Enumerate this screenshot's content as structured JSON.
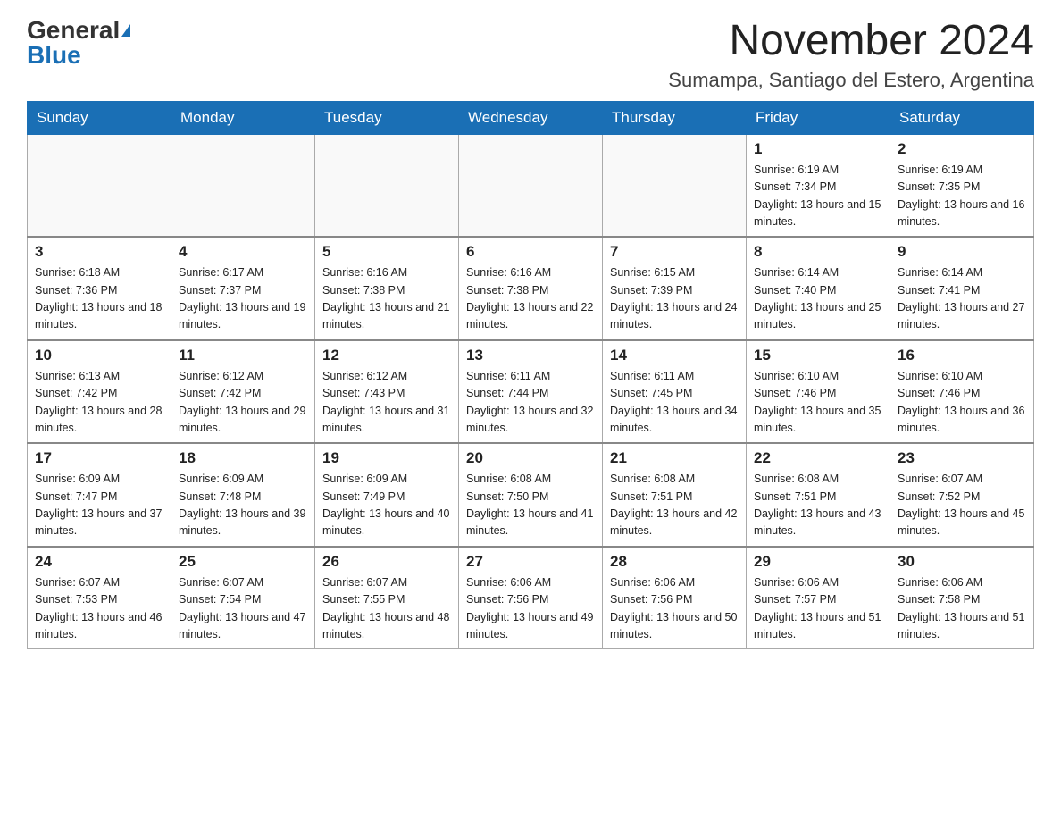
{
  "header": {
    "logo_general": "General",
    "logo_blue": "Blue",
    "month_title": "November 2024",
    "subtitle": "Sumampa, Santiago del Estero, Argentina"
  },
  "weekdays": [
    "Sunday",
    "Monday",
    "Tuesday",
    "Wednesday",
    "Thursday",
    "Friday",
    "Saturday"
  ],
  "weeks": [
    [
      {
        "day": "",
        "info": ""
      },
      {
        "day": "",
        "info": ""
      },
      {
        "day": "",
        "info": ""
      },
      {
        "day": "",
        "info": ""
      },
      {
        "day": "",
        "info": ""
      },
      {
        "day": "1",
        "info": "Sunrise: 6:19 AM\nSunset: 7:34 PM\nDaylight: 13 hours and 15 minutes."
      },
      {
        "day": "2",
        "info": "Sunrise: 6:19 AM\nSunset: 7:35 PM\nDaylight: 13 hours and 16 minutes."
      }
    ],
    [
      {
        "day": "3",
        "info": "Sunrise: 6:18 AM\nSunset: 7:36 PM\nDaylight: 13 hours and 18 minutes."
      },
      {
        "day": "4",
        "info": "Sunrise: 6:17 AM\nSunset: 7:37 PM\nDaylight: 13 hours and 19 minutes."
      },
      {
        "day": "5",
        "info": "Sunrise: 6:16 AM\nSunset: 7:38 PM\nDaylight: 13 hours and 21 minutes."
      },
      {
        "day": "6",
        "info": "Sunrise: 6:16 AM\nSunset: 7:38 PM\nDaylight: 13 hours and 22 minutes."
      },
      {
        "day": "7",
        "info": "Sunrise: 6:15 AM\nSunset: 7:39 PM\nDaylight: 13 hours and 24 minutes."
      },
      {
        "day": "8",
        "info": "Sunrise: 6:14 AM\nSunset: 7:40 PM\nDaylight: 13 hours and 25 minutes."
      },
      {
        "day": "9",
        "info": "Sunrise: 6:14 AM\nSunset: 7:41 PM\nDaylight: 13 hours and 27 minutes."
      }
    ],
    [
      {
        "day": "10",
        "info": "Sunrise: 6:13 AM\nSunset: 7:42 PM\nDaylight: 13 hours and 28 minutes."
      },
      {
        "day": "11",
        "info": "Sunrise: 6:12 AM\nSunset: 7:42 PM\nDaylight: 13 hours and 29 minutes."
      },
      {
        "day": "12",
        "info": "Sunrise: 6:12 AM\nSunset: 7:43 PM\nDaylight: 13 hours and 31 minutes."
      },
      {
        "day": "13",
        "info": "Sunrise: 6:11 AM\nSunset: 7:44 PM\nDaylight: 13 hours and 32 minutes."
      },
      {
        "day": "14",
        "info": "Sunrise: 6:11 AM\nSunset: 7:45 PM\nDaylight: 13 hours and 34 minutes."
      },
      {
        "day": "15",
        "info": "Sunrise: 6:10 AM\nSunset: 7:46 PM\nDaylight: 13 hours and 35 minutes."
      },
      {
        "day": "16",
        "info": "Sunrise: 6:10 AM\nSunset: 7:46 PM\nDaylight: 13 hours and 36 minutes."
      }
    ],
    [
      {
        "day": "17",
        "info": "Sunrise: 6:09 AM\nSunset: 7:47 PM\nDaylight: 13 hours and 37 minutes."
      },
      {
        "day": "18",
        "info": "Sunrise: 6:09 AM\nSunset: 7:48 PM\nDaylight: 13 hours and 39 minutes."
      },
      {
        "day": "19",
        "info": "Sunrise: 6:09 AM\nSunset: 7:49 PM\nDaylight: 13 hours and 40 minutes."
      },
      {
        "day": "20",
        "info": "Sunrise: 6:08 AM\nSunset: 7:50 PM\nDaylight: 13 hours and 41 minutes."
      },
      {
        "day": "21",
        "info": "Sunrise: 6:08 AM\nSunset: 7:51 PM\nDaylight: 13 hours and 42 minutes."
      },
      {
        "day": "22",
        "info": "Sunrise: 6:08 AM\nSunset: 7:51 PM\nDaylight: 13 hours and 43 minutes."
      },
      {
        "day": "23",
        "info": "Sunrise: 6:07 AM\nSunset: 7:52 PM\nDaylight: 13 hours and 45 minutes."
      }
    ],
    [
      {
        "day": "24",
        "info": "Sunrise: 6:07 AM\nSunset: 7:53 PM\nDaylight: 13 hours and 46 minutes."
      },
      {
        "day": "25",
        "info": "Sunrise: 6:07 AM\nSunset: 7:54 PM\nDaylight: 13 hours and 47 minutes."
      },
      {
        "day": "26",
        "info": "Sunrise: 6:07 AM\nSunset: 7:55 PM\nDaylight: 13 hours and 48 minutes."
      },
      {
        "day": "27",
        "info": "Sunrise: 6:06 AM\nSunset: 7:56 PM\nDaylight: 13 hours and 49 minutes."
      },
      {
        "day": "28",
        "info": "Sunrise: 6:06 AM\nSunset: 7:56 PM\nDaylight: 13 hours and 50 minutes."
      },
      {
        "day": "29",
        "info": "Sunrise: 6:06 AM\nSunset: 7:57 PM\nDaylight: 13 hours and 51 minutes."
      },
      {
        "day": "30",
        "info": "Sunrise: 6:06 AM\nSunset: 7:58 PM\nDaylight: 13 hours and 51 minutes."
      }
    ]
  ]
}
